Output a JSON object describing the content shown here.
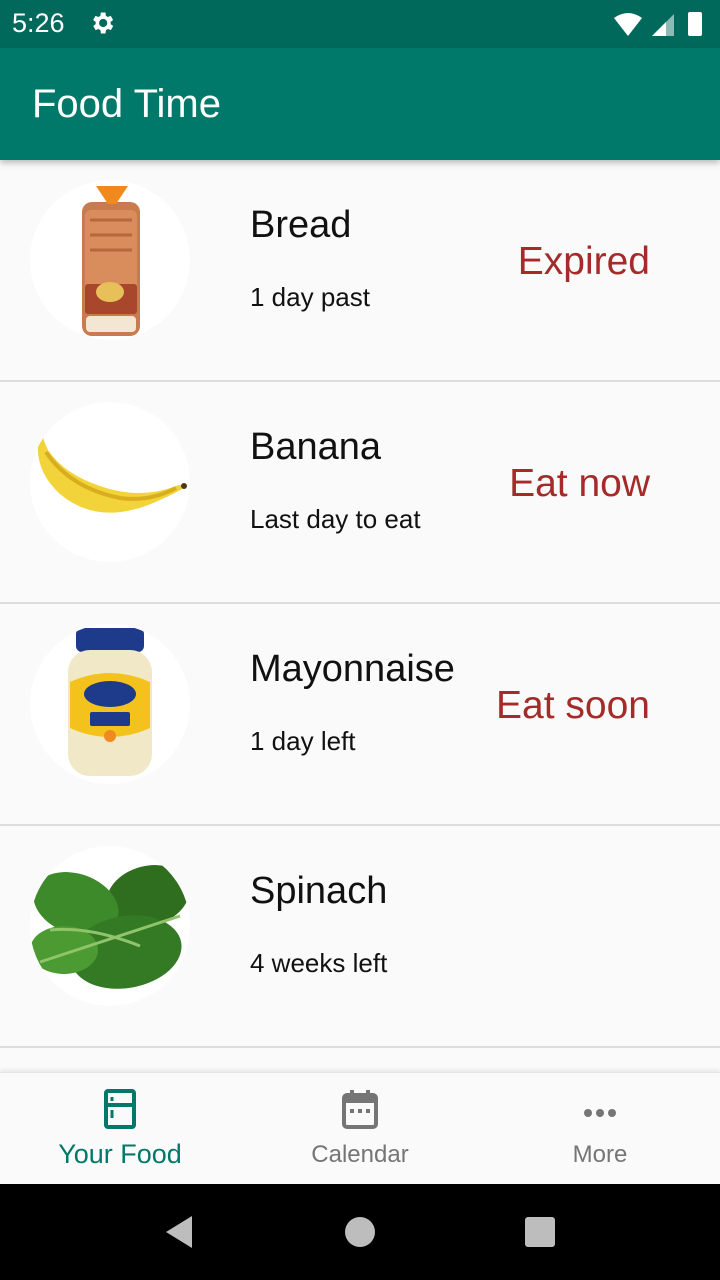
{
  "status_bar": {
    "time": "5:26",
    "icons": [
      "settings-gear-icon",
      "wifi-icon",
      "cellular-signal-icon",
      "battery-icon"
    ]
  },
  "app_bar": {
    "title": "Food Time"
  },
  "foods": [
    {
      "name": "Bread",
      "days": "1 day past",
      "status": "Expired",
      "image": "bread-loaf"
    },
    {
      "name": "Banana",
      "days": "Last day to eat",
      "status": "Eat now",
      "image": "banana"
    },
    {
      "name": "Mayonnaise",
      "days": "1 day left",
      "status": "Eat soon",
      "image": "mayonnaise-jar"
    },
    {
      "name": "Spinach",
      "days": "4 weeks left",
      "status": "",
      "image": "spinach-leaves"
    }
  ],
  "bottom_nav": {
    "tabs": [
      {
        "label": "Your Food",
        "icon": "fridge-icon",
        "active": true
      },
      {
        "label": "Calendar",
        "icon": "calendar-icon",
        "active": false
      },
      {
        "label": "More",
        "icon": "more-dots-icon",
        "active": false
      }
    ]
  },
  "system_nav": {
    "buttons": [
      "back-icon",
      "home-icon",
      "recents-icon"
    ]
  },
  "colors": {
    "status_bar": "#00695c",
    "app_bar": "#00796b",
    "accent": "#00796b",
    "warning": "#a52a2a"
  }
}
